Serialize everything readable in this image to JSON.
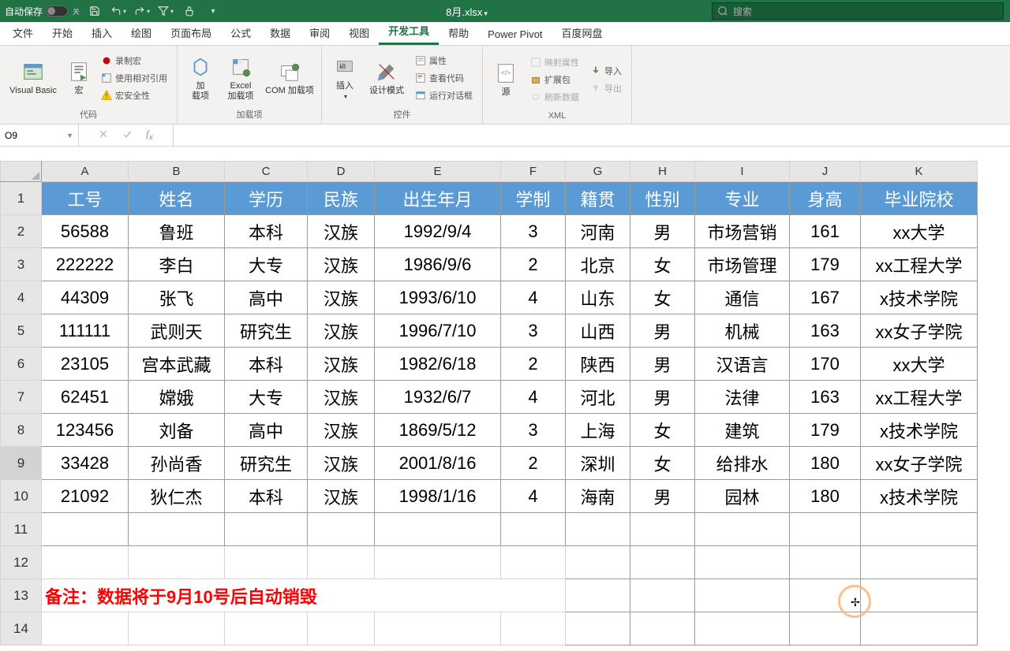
{
  "titlebar": {
    "autosave": "自动保存",
    "toggleState": "关",
    "filename": "8月.xlsx",
    "searchPlaceholder": "搜索"
  },
  "tabs": [
    "文件",
    "开始",
    "插入",
    "绘图",
    "页面布局",
    "公式",
    "数据",
    "审阅",
    "视图",
    "开发工具",
    "帮助",
    "Power Pivot",
    "百度网盘"
  ],
  "activeTab": "开发工具",
  "ribbon": {
    "code": {
      "vb": "Visual Basic",
      "macro": "宏",
      "record": "录制宏",
      "relative": "使用相对引用",
      "security": "宏安全性",
      "label": "代码"
    },
    "addins": {
      "addin": "加\n载项",
      "excelAddin": "Excel\n加载项",
      "comAddin": "COM 加载项",
      "label": "加载项"
    },
    "controls": {
      "insert": "插入",
      "design": "设计模式",
      "properties": "属性",
      "viewCode": "查看代码",
      "runDialog": "运行对话框",
      "label": "控件"
    },
    "xml": {
      "source": "源",
      "mapProps": "映射属性",
      "expand": "扩展包",
      "refresh": "刷新数据",
      "import": "导入",
      "export": "导出",
      "label": "XML"
    }
  },
  "namebox": "O9",
  "colHeaders": [
    "A",
    "B",
    "C",
    "D",
    "E",
    "F",
    "G",
    "H",
    "I",
    "J",
    "K"
  ],
  "tableHeaders": [
    "工号",
    "姓名",
    "学历",
    "民族",
    "出生年月",
    "学制",
    "籍贯",
    "性别",
    "专业",
    "身高",
    "毕业院校"
  ],
  "rows": [
    [
      "56588",
      "鲁班",
      "本科",
      "汉族",
      "1992/9/4",
      "3",
      "河南",
      "男",
      "市场营销",
      "161",
      "xx大学"
    ],
    [
      "222222",
      "李白",
      "大专",
      "汉族",
      "1986/9/6",
      "2",
      "北京",
      "女",
      "市场管理",
      "179",
      "xx工程大学"
    ],
    [
      "44309",
      "张飞",
      "高中",
      "汉族",
      "1993/6/10",
      "4",
      "山东",
      "女",
      "通信",
      "167",
      "x技术学院"
    ],
    [
      "111111",
      "武则天",
      "研究生",
      "汉族",
      "1996/7/10",
      "3",
      "山西",
      "男",
      "机械",
      "163",
      "xx女子学院"
    ],
    [
      "23105",
      "宫本武藏",
      "本科",
      "汉族",
      "1982/6/18",
      "2",
      "陕西",
      "男",
      "汉语言",
      "170",
      "xx大学"
    ],
    [
      "62451",
      "嫦娥",
      "大专",
      "汉族",
      "1932/6/7",
      "4",
      "河北",
      "男",
      "法律",
      "163",
      "xx工程大学"
    ],
    [
      "123456",
      "刘备",
      "高中",
      "汉族",
      "1869/5/12",
      "3",
      "上海",
      "女",
      "建筑",
      "179",
      "x技术学院"
    ],
    [
      "33428",
      "孙尚香",
      "研究生",
      "汉族",
      "2001/8/16",
      "2",
      "深圳",
      "女",
      "给排水",
      "180",
      "xx女子学院"
    ],
    [
      "21092",
      "狄仁杰",
      "本科",
      "汉族",
      "1998/1/16",
      "4",
      "海南",
      "男",
      "园林",
      "180",
      "x技术学院"
    ]
  ],
  "note": "备注：数据将于9月10号后自动销毁"
}
